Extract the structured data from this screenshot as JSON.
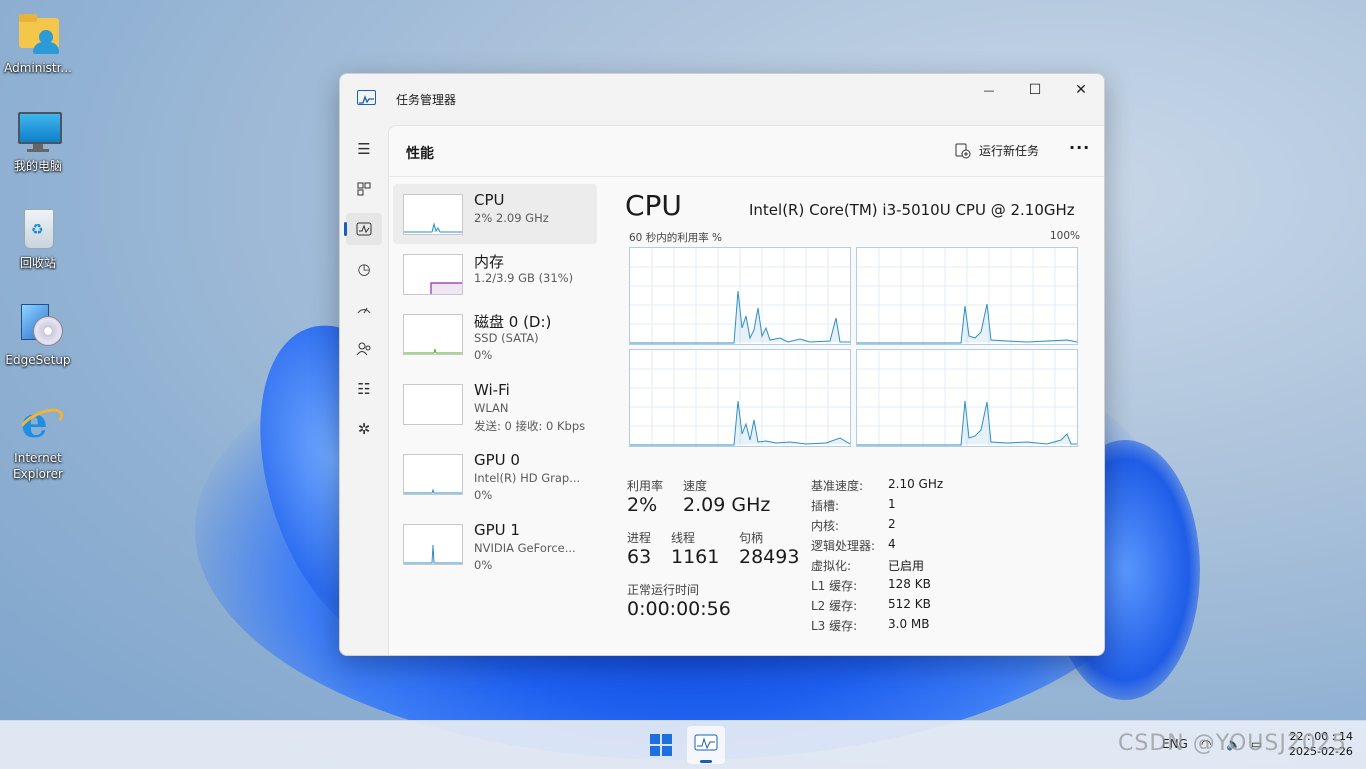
{
  "desktop": {
    "icons": [
      {
        "label": "Administr..."
      },
      {
        "label": "我的电脑"
      },
      {
        "label": "回收站"
      },
      {
        "label": "EdgeSetup"
      },
      {
        "label": "Internet Explorer"
      }
    ]
  },
  "window": {
    "title": "任务管理器",
    "controls": {
      "minimize": "—",
      "maximize": "☐",
      "close": "✕"
    }
  },
  "header": {
    "page_title": "性能",
    "run_new_task": "运行新任务",
    "more": "···"
  },
  "devices": [
    {
      "name": "CPU",
      "s1": "2% 2.09 GHz",
      "s2": ""
    },
    {
      "name": "内存",
      "s1": "1.2/3.9 GB (31%)",
      "s2": ""
    },
    {
      "name": "磁盘 0 (D:)",
      "s1": "SSD (SATA)",
      "s2": "0%"
    },
    {
      "name": "Wi-Fi",
      "s1": "WLAN",
      "s2": "发送: 0 接收: 0 Kbps"
    },
    {
      "name": "GPU 0",
      "s1": "Intel(R) HD Grap...",
      "s2": "0%"
    },
    {
      "name": "GPU 1",
      "s1": "NVIDIA GeForce...",
      "s2": "0%"
    }
  ],
  "detail": {
    "title": "CPU",
    "model": "Intel(R) Core(TM) i3-5010U CPU @ 2.10GHz",
    "graph_label": "60 秒内的利用率 %",
    "graph_max": "100%",
    "stats": {
      "util_label": "利用率",
      "util_value": "2%",
      "speed_label": "速度",
      "speed_value": "2.09 GHz",
      "proc_label": "进程",
      "proc_value": "63",
      "thread_label": "线程",
      "thread_value": "1161",
      "handle_label": "句柄",
      "handle_value": "28493",
      "uptime_label": "正常运行时间",
      "uptime_value": "0:00:00:56"
    },
    "specs": [
      {
        "k": "基准速度:",
        "v": "2.10 GHz"
      },
      {
        "k": "插槽:",
        "v": "1"
      },
      {
        "k": "内核:",
        "v": "2"
      },
      {
        "k": "逻辑处理器:",
        "v": "4"
      },
      {
        "k": "虚拟化:",
        "v": "已启用"
      },
      {
        "k": "L1 缓存:",
        "v": "128 KB"
      },
      {
        "k": "L2 缓存:",
        "v": "512 KB"
      },
      {
        "k": "L3 缓存:",
        "v": "3.0 MB"
      }
    ]
  },
  "taskbar": {
    "tray_lang": "ENG",
    "time": "22 : 00 : 14",
    "date": "2025-02-26"
  },
  "watermark": "CSDN @YOUSJ2025",
  "colors": {
    "accent": "#1a5fb4",
    "cpu_line": "#2f8fc4",
    "mem_line": "#8b2fa8",
    "disk_line": "#4fae2e"
  }
}
